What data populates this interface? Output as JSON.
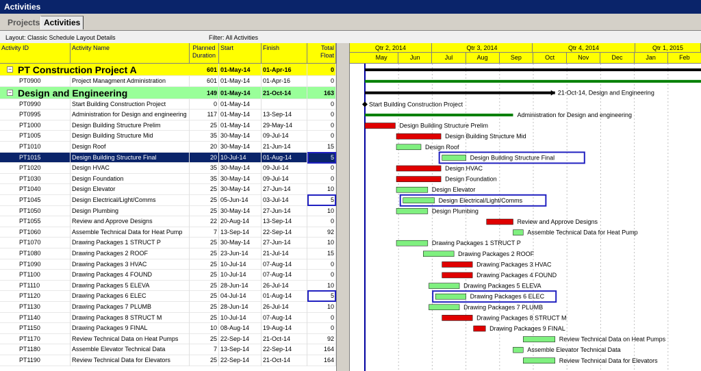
{
  "window": {
    "title": "Activities"
  },
  "tabs": [
    {
      "label": "Projects"
    },
    {
      "label": "Activities"
    }
  ],
  "toolbar": {
    "layout": "Layout: Classic Schedule Layout Details",
    "filter": "Filter: All Activities"
  },
  "columns": {
    "id": "Activity ID",
    "name": "Activity Name",
    "duration": "Planned Duration",
    "start": "Start",
    "finish": "Finish",
    "float": "Total Float"
  },
  "groups": {
    "project": {
      "name": "PT Construction Project A",
      "duration": "601",
      "start": "01-May-14",
      "finish": "01-Apr-16",
      "float": "0"
    },
    "wbs": {
      "name": "Design and Engineering",
      "duration": "149",
      "start": "01-May-14",
      "finish": "21-Oct-14",
      "float": "163"
    }
  },
  "activities": [
    {
      "id": "PT0900",
      "name": "Project Managment Administration",
      "duration": "601",
      "start": "01-May-14",
      "finish": "01-Apr-16",
      "float": "0"
    },
    {
      "id": "PT0990",
      "name": "Start Building Construction Project",
      "duration": "0",
      "start": "01-May-14",
      "finish": "",
      "float": "0"
    },
    {
      "id": "PT0995",
      "name": "Administration for Design and engineering",
      "duration": "117",
      "start": "01-May-14",
      "finish": "13-Sep-14",
      "float": "0"
    },
    {
      "id": "PT1000",
      "name": "Design Building Structure Prelim",
      "duration": "25",
      "start": "01-May-14",
      "finish": "29-May-14",
      "float": "0"
    },
    {
      "id": "PT1005",
      "name": "Design Building Structure Mid",
      "duration": "35",
      "start": "30-May-14",
      "finish": "09-Jul-14",
      "float": "0"
    },
    {
      "id": "PT1010",
      "name": "Design Roof",
      "duration": "20",
      "start": "30-May-14",
      "finish": "21-Jun-14",
      "float": "15"
    },
    {
      "id": "PT1015",
      "name": "Design Building Structure Final",
      "duration": "20",
      "start": "10-Jul-14",
      "finish": "01-Aug-14",
      "float": "5"
    },
    {
      "id": "PT1020",
      "name": "Design HVAC",
      "duration": "35",
      "start": "30-May-14",
      "finish": "09-Jul-14",
      "float": "0"
    },
    {
      "id": "PT1030",
      "name": "Design Foundation",
      "duration": "35",
      "start": "30-May-14",
      "finish": "09-Jul-14",
      "float": "0"
    },
    {
      "id": "PT1040",
      "name": "Design Elevator",
      "duration": "25",
      "start": "30-May-14",
      "finish": "27-Jun-14",
      "float": "10"
    },
    {
      "id": "PT1045",
      "name": "Design Electrical/Light/Comms",
      "duration": "25",
      "start": "05-Jun-14",
      "finish": "03-Jul-14",
      "float": "5"
    },
    {
      "id": "PT1050",
      "name": "Design Plumbing",
      "duration": "25",
      "start": "30-May-14",
      "finish": "27-Jun-14",
      "float": "10"
    },
    {
      "id": "PT1055",
      "name": "Review and Approve Designs",
      "duration": "22",
      "start": "20-Aug-14",
      "finish": "13-Sep-14",
      "float": "0"
    },
    {
      "id": "PT1060",
      "name": "Assemble Technical Data for Heat Pump",
      "duration": "7",
      "start": "13-Sep-14",
      "finish": "22-Sep-14",
      "float": "92"
    },
    {
      "id": "PT1070",
      "name": "Drawing Packages 1 STRUCT P",
      "duration": "25",
      "start": "30-May-14",
      "finish": "27-Jun-14",
      "float": "10"
    },
    {
      "id": "PT1080",
      "name": "Drawing Packages 2 ROOF",
      "duration": "25",
      "start": "23-Jun-14",
      "finish": "21-Jul-14",
      "float": "15"
    },
    {
      "id": "PT1090",
      "name": "Drawing Packages 3 HVAC",
      "duration": "25",
      "start": "10-Jul-14",
      "finish": "07-Aug-14",
      "float": "0"
    },
    {
      "id": "PT1100",
      "name": "Drawing Packages 4 FOUND",
      "duration": "25",
      "start": "10-Jul-14",
      "finish": "07-Aug-14",
      "float": "0"
    },
    {
      "id": "PT1110",
      "name": "Drawing Packages 5 ELEVA",
      "duration": "25",
      "start": "28-Jun-14",
      "finish": "26-Jul-14",
      "float": "10"
    },
    {
      "id": "PT1120",
      "name": "Drawing Packages 6 ELEC",
      "duration": "25",
      "start": "04-Jul-14",
      "finish": "01-Aug-14",
      "float": "5"
    },
    {
      "id": "PT1130",
      "name": "Drawing Packages 7 PLUMB",
      "duration": "25",
      "start": "28-Jun-14",
      "finish": "26-Jul-14",
      "float": "10"
    },
    {
      "id": "PT1140",
      "name": "Drawing Packages 8 STRUCT M",
      "duration": "25",
      "start": "10-Jul-14",
      "finish": "07-Aug-14",
      "float": "0"
    },
    {
      "id": "PT1150",
      "name": "Drawing Packages 9 FINAL",
      "duration": "10",
      "start": "08-Aug-14",
      "finish": "19-Aug-14",
      "float": "0"
    },
    {
      "id": "PT1170",
      "name": "Review Technical Data on Heat Pumps",
      "duration": "25",
      "start": "22-Sep-14",
      "finish": "21-Oct-14",
      "float": "92"
    },
    {
      "id": "PT1180",
      "name": "Assemble Elevator Technical Data",
      "duration": "7",
      "start": "13-Sep-14",
      "finish": "22-Sep-14",
      "float": "164"
    },
    {
      "id": "PT1190",
      "name": "Review Technical Data for Elevators",
      "duration": "25",
      "start": "22-Sep-14",
      "finish": "21-Oct-14",
      "float": "164"
    }
  ],
  "timeline": {
    "quarters": [
      "Qtr 2, 2014",
      "Qtr 3, 2014",
      "Qtr 4, 2014",
      "Qtr 1, 2015"
    ],
    "months": [
      "May",
      "Jun",
      "Jul",
      "Aug",
      "Sep",
      "Oct",
      "Nov",
      "Dec",
      "Jan",
      "Feb"
    ]
  },
  "gantt_labels": {
    "wbs_summary": "21-Oct-14, Design and Engineering",
    "admin": "Administration for Design and engineering",
    "start_milestone": "Start Building Construction Project"
  },
  "colors": {
    "critical": "#e00000",
    "noncritical": "#80f080",
    "summary": "#000000",
    "admin": "#008000",
    "highlight_box": "#2020c0",
    "header": "#ffff00",
    "wbs_band": "#99ff99"
  }
}
